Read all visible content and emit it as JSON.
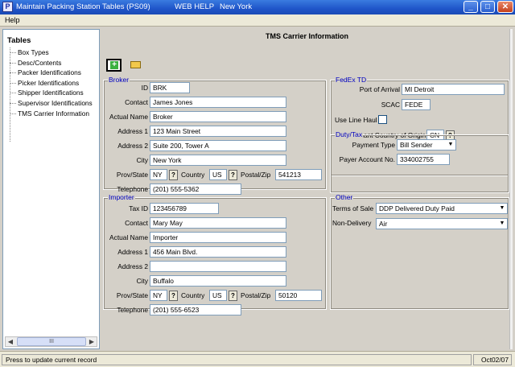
{
  "window": {
    "title": "Maintain Packing Station Tables (PS09)",
    "web_help": "WEB HELP",
    "location": "New York",
    "app_icon": "P"
  },
  "menu": {
    "help": "Help"
  },
  "tables": {
    "heading": "Tables",
    "items": [
      "Box Types",
      "Desc/Contents",
      "Packer Identifications",
      "Picker Identifications",
      "Shipper Identifications",
      "Supervisor Identifications",
      "TMS Carrier Information"
    ],
    "scroll_thumb": "III"
  },
  "form": {
    "title": "TMS Carrier Information",
    "broker": {
      "legend": "Broker",
      "id_label": "ID",
      "id": "BRK",
      "contact_label": "Contact",
      "contact": "James Jones",
      "actual_name_label": "Actual Name",
      "actual_name": "Broker",
      "address1_label": "Address 1",
      "address1": "123 Main Street",
      "address2_label": "Address 2",
      "address2": "Suite 200, Tower A",
      "city_label": "City",
      "city": "New York",
      "prov_state_label": "Prov/State",
      "prov_state": "NY",
      "country_label": "Country",
      "country": "US",
      "postal_label": "Postal/Zip",
      "postal": "541213",
      "telephone_label": "Telephone",
      "telephone": "(201) 555-5362"
    },
    "fedex": {
      "legend": "FedEx TD",
      "port_label": "Port of Arrival",
      "port": "MI Detroit",
      "scac_label": "SCAC",
      "scac": "FEDE",
      "line_haul_label": "Use Line Haul",
      "line_haul": false,
      "origin_label": "Predominant Country of Origin",
      "origin": "CN"
    },
    "duty": {
      "legend": "Duty/Tax",
      "payment_type_label": "Payment Type",
      "payment_type": "Bill Sender",
      "payer_label": "Payer Account No.",
      "payer": "334002755"
    },
    "importer": {
      "legend": "Importer",
      "tax_id_label": "Tax ID",
      "tax_id": "123456789",
      "contact_label": "Contact",
      "contact": "Mary May",
      "actual_name_label": "Actual Name",
      "actual_name": "Importer",
      "address1_label": "Address 1",
      "address1": "456 Main Blvd.",
      "address2_label": "Address 2",
      "address2": "",
      "city_label": "City",
      "city": "Buffalo",
      "prov_state_label": "Prov/State",
      "prov_state": "NY",
      "country_label": "Country",
      "country": "US",
      "postal_label": "Postal/Zip",
      "postal": "50120",
      "telephone_label": "Telephone",
      "telephone": "(201) 555-6523"
    },
    "other": {
      "legend": "Other",
      "terms_label": "Terms of Sale",
      "terms": "DDP Delivered Duty Paid",
      "non_delivery_label": "Non-Delivery",
      "non_delivery": "Air"
    }
  },
  "status": {
    "message": "Press to update current record",
    "date": "Oct02/07"
  },
  "icons": {
    "add": "add-record-icon",
    "open": "folder-icon",
    "lookup": "?"
  }
}
